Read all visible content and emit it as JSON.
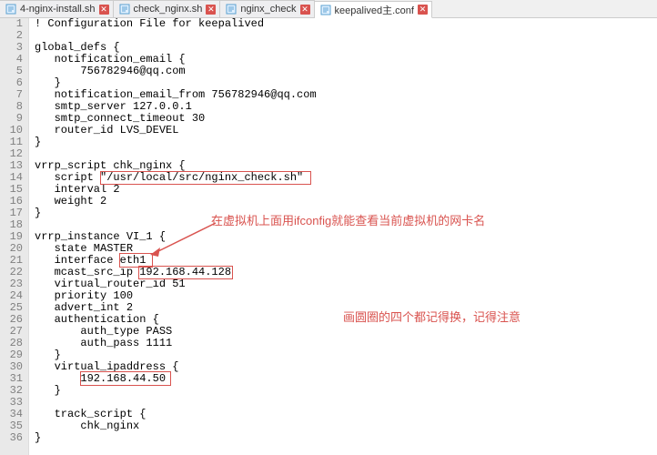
{
  "tabs": [
    {
      "label": "4-nginx-install.sh",
      "active": false
    },
    {
      "label": "check_nginx.sh",
      "active": false
    },
    {
      "label": "nginx_check",
      "active": false
    },
    {
      "label": "keepalived主.conf",
      "active": true
    }
  ],
  "close_glyph": "✕",
  "code_lines": [
    "! Configuration File for keepalived",
    "",
    "global_defs {",
    "   notification_email {",
    "       756782946@qq.com",
    "   }",
    "   notification_email_from 756782946@qq.com",
    "   smtp_server 127.0.0.1",
    "   smtp_connect_timeout 30",
    "   router_id LVS_DEVEL",
    "}",
    "",
    "vrrp_script chk_nginx {",
    "   script \"/usr/local/src/nginx_check.sh\"",
    "   interval 2",
    "   weight 2",
    "}",
    "",
    "vrrp_instance VI_1 {",
    "   state MASTER",
    "   interface eth1",
    "   mcast_src_ip 192.168.44.128",
    "   virtual_router_id 51",
    "   priority 100",
    "   advert_int 2",
    "   authentication {",
    "       auth_type PASS",
    "       auth_pass 1111",
    "   }",
    "   virtual_ipaddress {",
    "       192.168.44.50",
    "   }",
    "",
    "   track_script {",
    "       chk_nginx",
    "}"
  ],
  "annotations": {
    "top": "在虚拟机上面用ifconfig就能查看当前虚拟机的网卡名",
    "right": "画圆圈的四个都记得换，记得注意"
  },
  "boxes": {
    "script_path": {
      "value": "\"/usr/local/src/nginx_check.sh\""
    },
    "interface": {
      "value": "eth1"
    },
    "mcast_src_ip": {
      "value": "192.168.44.128"
    },
    "vip": {
      "value": "192.168.44.50"
    }
  }
}
